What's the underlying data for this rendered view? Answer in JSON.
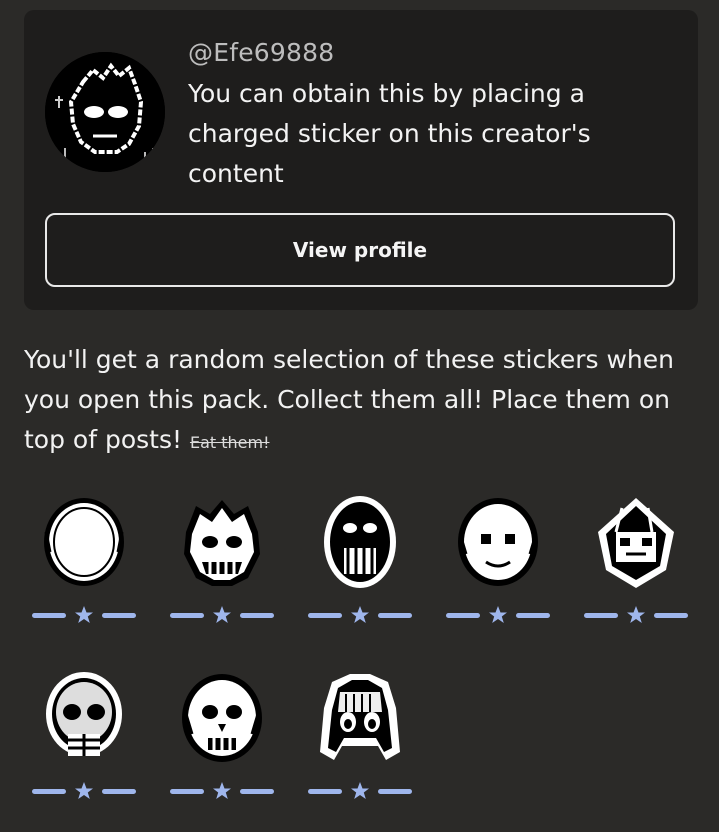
{
  "creator": {
    "handle": "@Efe69888",
    "info": "You can obtain this by placing a charged sticker on this creator's content",
    "view_profile_label": "View profile"
  },
  "pack": {
    "description": "You'll get a random selection of these stickers when you open this pack. Collect them all! Place them on top of posts!",
    "strikethrough": "Eat them!"
  },
  "stickers": [
    {
      "name": "blank-face",
      "rating_icon": "star-icon"
    },
    {
      "name": "grinning-skull",
      "rating_icon": "star-icon"
    },
    {
      "name": "screaming-face",
      "rating_icon": "star-icon"
    },
    {
      "name": "smiling-face",
      "rating_icon": "star-icon"
    },
    {
      "name": "dark-face",
      "rating_icon": "star-icon"
    },
    {
      "name": "skull-jaw",
      "rating_icon": "star-icon"
    },
    {
      "name": "round-skull",
      "rating_icon": "star-icon"
    },
    {
      "name": "long-hair-face",
      "rating_icon": "star-icon"
    }
  ],
  "colors": {
    "background": "#2b2a28",
    "card": "#1e1d1c",
    "rating_accent": "#9fb6ec"
  }
}
